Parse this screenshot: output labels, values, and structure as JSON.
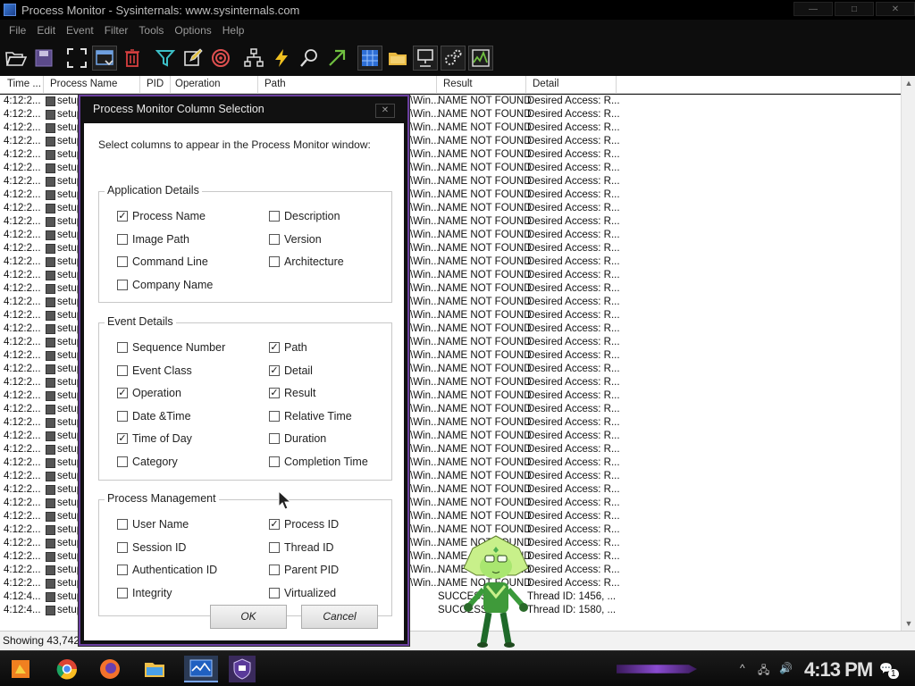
{
  "window": {
    "title": "Process Monitor - Sysinternals: www.sysinternals.com",
    "controls": [
      "—",
      "□",
      "✕"
    ]
  },
  "menu": [
    "File",
    "Edit",
    "Event",
    "Filter",
    "Tools",
    "Options",
    "Help"
  ],
  "toolbar_icons": [
    "open-icon",
    "save-icon",
    "autoscroll-icon",
    "capture-icon",
    "clear-icon",
    "filter-icon",
    "highlight-icon",
    "target-icon",
    "process-tree-icon",
    "event-icon",
    "find-icon",
    "jump-icon",
    "registry-icon",
    "filesystem-icon",
    "network-icon",
    "process-thread-icon",
    "profiling-icon"
  ],
  "columns": [
    "Time ...",
    "Process Name",
    "PID",
    "Operation",
    "Path",
    "Result",
    "Detail"
  ],
  "rows": [
    {
      "time": "4:12:2...",
      "proc": "setup",
      "path": "\\Win...",
      "result": "NAME NOT FOUND",
      "detail": "Desired Access: R..."
    },
    {
      "time": "4:12:2...",
      "proc": "setup",
      "path": "\\Win...",
      "result": "NAME NOT FOUND",
      "detail": "Desired Access: R..."
    },
    {
      "time": "4:12:2...",
      "proc": "setup",
      "path": "\\Win...",
      "result": "NAME NOT FOUND",
      "detail": "Desired Access: R..."
    },
    {
      "time": "4:12:2...",
      "proc": "setup",
      "path": "\\Win...",
      "result": "NAME NOT FOUND",
      "detail": "Desired Access: R..."
    },
    {
      "time": "4:12:2...",
      "proc": "setup",
      "path": "\\Win...",
      "result": "NAME NOT FOUND",
      "detail": "Desired Access: R..."
    },
    {
      "time": "4:12:2...",
      "proc": "setup",
      "path": "\\Win...",
      "result": "NAME NOT FOUND",
      "detail": "Desired Access: R..."
    },
    {
      "time": "4:12:2...",
      "proc": "setup",
      "path": "\\Win...",
      "result": "NAME NOT FOUND",
      "detail": "Desired Access: R..."
    },
    {
      "time": "4:12:2...",
      "proc": "setup",
      "path": "\\Win...",
      "result": "NAME NOT FOUND",
      "detail": "Desired Access: R..."
    },
    {
      "time": "4:12:2...",
      "proc": "setup",
      "path": "\\Win...",
      "result": "NAME NOT FOUND",
      "detail": "Desired Access: R..."
    },
    {
      "time": "4:12:2...",
      "proc": "setup",
      "path": "\\Win...",
      "result": "NAME NOT FOUND",
      "detail": "Desired Access: R..."
    },
    {
      "time": "4:12:2...",
      "proc": "setup",
      "path": "\\Win...",
      "result": "NAME NOT FOUND",
      "detail": "Desired Access: R..."
    },
    {
      "time": "4:12:2...",
      "proc": "setup",
      "path": "\\Win...",
      "result": "NAME NOT FOUND",
      "detail": "Desired Access: R..."
    },
    {
      "time": "4:12:2...",
      "proc": "setup",
      "path": "\\Win...",
      "result": "NAME NOT FOUND",
      "detail": "Desired Access: R..."
    },
    {
      "time": "4:12:2...",
      "proc": "setup",
      "path": "\\Win...",
      "result": "NAME NOT FOUND",
      "detail": "Desired Access: R..."
    },
    {
      "time": "4:12:2...",
      "proc": "setup",
      "path": "\\Win...",
      "result": "NAME NOT FOUND",
      "detail": "Desired Access: R..."
    },
    {
      "time": "4:12:2...",
      "proc": "setup",
      "path": "\\Win...",
      "result": "NAME NOT FOUND",
      "detail": "Desired Access: R..."
    },
    {
      "time": "4:12:2...",
      "proc": "setup",
      "path": "\\Win...",
      "result": "NAME NOT FOUND",
      "detail": "Desired Access: R..."
    },
    {
      "time": "4:12:2...",
      "proc": "setup",
      "path": "\\Win...",
      "result": "NAME NOT FOUND",
      "detail": "Desired Access: R..."
    },
    {
      "time": "4:12:2...",
      "proc": "setup",
      "path": "\\Win...",
      "result": "NAME NOT FOUND",
      "detail": "Desired Access: R..."
    },
    {
      "time": "4:12:2...",
      "proc": "setup",
      "path": "\\Win...",
      "result": "NAME NOT FOUND",
      "detail": "Desired Access: R..."
    },
    {
      "time": "4:12:2...",
      "proc": "setup",
      "path": "\\Win...",
      "result": "NAME NOT FOUND",
      "detail": "Desired Access: R..."
    },
    {
      "time": "4:12:2...",
      "proc": "setup",
      "path": "\\Win...",
      "result": "NAME NOT FOUND",
      "detail": "Desired Access: R..."
    },
    {
      "time": "4:12:2...",
      "proc": "setup",
      "path": "\\Win...",
      "result": "NAME NOT FOUND",
      "detail": "Desired Access: R..."
    },
    {
      "time": "4:12:2...",
      "proc": "setup",
      "path": "\\Win...",
      "result": "NAME NOT FOUND",
      "detail": "Desired Access: R..."
    },
    {
      "time": "4:12:2...",
      "proc": "setup",
      "path": "\\Win...",
      "result": "NAME NOT FOUND",
      "detail": "Desired Access: R..."
    },
    {
      "time": "4:12:2...",
      "proc": "setup",
      "path": "\\Win...",
      "result": "NAME NOT FOUND",
      "detail": "Desired Access: R..."
    },
    {
      "time": "4:12:2...",
      "proc": "setup",
      "path": "\\Win...",
      "result": "NAME NOT FOUND",
      "detail": "Desired Access: R..."
    },
    {
      "time": "4:12:2...",
      "proc": "setup",
      "path": "\\Win...",
      "result": "NAME NOT FOUND",
      "detail": "Desired Access: R..."
    },
    {
      "time": "4:12:2...",
      "proc": "setup",
      "path": "\\Win...",
      "result": "NAME NOT FOUND",
      "detail": "Desired Access: R..."
    },
    {
      "time": "4:12:2...",
      "proc": "setup",
      "path": "\\Win...",
      "result": "NAME NOT FOUND",
      "detail": "Desired Access: R..."
    },
    {
      "time": "4:12:2...",
      "proc": "setup",
      "path": "\\Win...",
      "result": "NAME NOT FOUND",
      "detail": "Desired Access: R..."
    },
    {
      "time": "4:12:2...",
      "proc": "setup",
      "path": "\\Win...",
      "result": "NAME NOT FOUND",
      "detail": "Desired Access: R..."
    },
    {
      "time": "4:12:2...",
      "proc": "setup",
      "path": "\\Win...",
      "result": "NAME NOT FOUND",
      "detail": "Desired Access: R..."
    },
    {
      "time": "4:12:2...",
      "proc": "setup",
      "path": "\\Win...",
      "result": "NAME NOT FOUND",
      "detail": "Desired Access: R..."
    },
    {
      "time": "4:12:2...",
      "proc": "setup",
      "path": "\\Win...",
      "result": "NAME NOT FOUND",
      "detail": "Desired Access: R..."
    },
    {
      "time": "4:12:2...",
      "proc": "setup",
      "path": "\\Win...",
      "result": "NAME NOT FOUND",
      "detail": "Desired Access: R..."
    },
    {
      "time": "4:12:2...",
      "proc": "setup",
      "path": "\\Win...",
      "result": "NAME NOT FOUND",
      "detail": "Desired Access: R..."
    },
    {
      "time": "4:12:4...",
      "proc": "setup",
      "path": "",
      "result": "SUCCESS",
      "detail": "Thread ID: 1456, ..."
    },
    {
      "time": "4:12:4...",
      "proc": "setup",
      "path": "",
      "result": "SUCCESS",
      "detail": "Thread ID: 1580, ..."
    }
  ],
  "status": "Showing 43,742",
  "dialog": {
    "title": "Process Monitor Column Selection",
    "close": "✕",
    "instruction": "Select columns to appear in the Process Monitor window:",
    "groups": [
      {
        "title": "Application Details",
        "items": [
          {
            "label": "Process Name",
            "checked": true
          },
          {
            "label": "Description",
            "checked": false
          },
          {
            "label": "Image Path",
            "checked": false
          },
          {
            "label": "Version",
            "checked": false
          },
          {
            "label": "Command Line",
            "checked": false
          },
          {
            "label": "Architecture",
            "checked": false
          },
          {
            "label": "Company Name",
            "checked": false
          }
        ]
      },
      {
        "title": "Event Details",
        "items": [
          {
            "label": "Sequence Number",
            "checked": false
          },
          {
            "label": "Path",
            "checked": true
          },
          {
            "label": "Event Class",
            "checked": false
          },
          {
            "label": "Detail",
            "checked": true
          },
          {
            "label": "Operation",
            "checked": true
          },
          {
            "label": "Result",
            "checked": true
          },
          {
            "label": "Date &Time",
            "checked": false
          },
          {
            "label": "Relative Time",
            "checked": false
          },
          {
            "label": "Time of Day",
            "checked": true
          },
          {
            "label": "Duration",
            "checked": false
          },
          {
            "label": "Category",
            "checked": false
          },
          {
            "label": "Completion Time",
            "checked": false
          }
        ]
      },
      {
        "title": "Process Management",
        "items": [
          {
            "label": "User Name",
            "checked": false
          },
          {
            "label": "Process ID",
            "checked": true
          },
          {
            "label": "Session ID",
            "checked": false
          },
          {
            "label": "Thread ID",
            "checked": false
          },
          {
            "label": "Authentication ID",
            "checked": false
          },
          {
            "label": "Parent PID",
            "checked": false
          },
          {
            "label": "Integrity",
            "checked": false
          },
          {
            "label": "Virtualized",
            "checked": false
          }
        ]
      }
    ],
    "ok": "OK",
    "cancel": "Cancel"
  },
  "taskbar": {
    "clock": "4:13 PM",
    "notification_count": "1",
    "apps": [
      "start-icon",
      "chrome-icon",
      "firefox-icon",
      "file-explorer-icon",
      "process-monitor-icon",
      "shield-app-icon"
    ]
  },
  "colors": {
    "accent": "#6b3fa0",
    "titlebar": "#000000",
    "list_bg": "#ffffff"
  }
}
